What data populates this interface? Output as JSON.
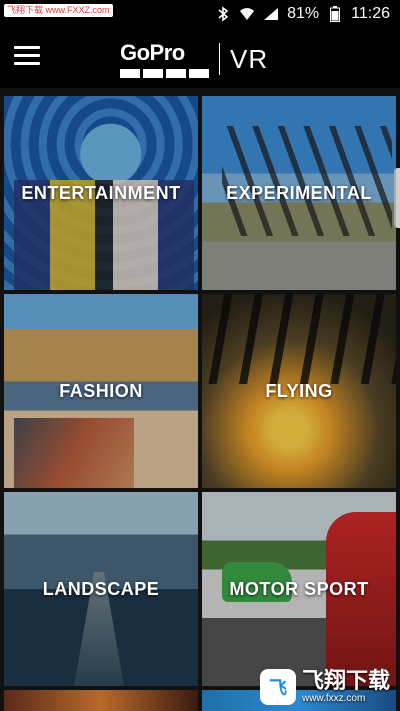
{
  "status_bar": {
    "watermark_text": "飞翔下载 www.FXXZ.com",
    "battery_percent": "81%",
    "time": "11:26",
    "icons": [
      "bluetooth-icon",
      "wifi-icon",
      "signal-icon",
      "battery-icon"
    ]
  },
  "app_bar": {
    "menu_icon": "hamburger-menu-icon",
    "brand_gopro": "GoPro",
    "brand_vr": "VR"
  },
  "categories": [
    {
      "label": "ENTERTAINMENT"
    },
    {
      "label": "EXPERIMENTAL"
    },
    {
      "label": "FASHION"
    },
    {
      "label": "FLYING"
    },
    {
      "label": "LANDSCAPE"
    },
    {
      "label": "MOTOR SPORT"
    }
  ],
  "watermark_bottom": {
    "logo_text": "飞",
    "name": "飞翔下载",
    "url": "www.fxxz.com"
  }
}
